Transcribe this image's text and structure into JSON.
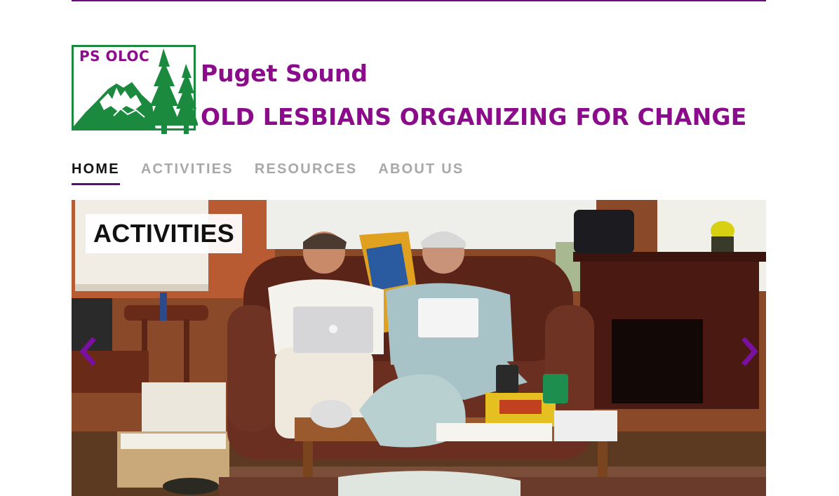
{
  "header": {
    "logo_abbrev": "PS OLOC",
    "title_line1": "Puget Sound",
    "title_line2": "OLD LESBIANS ORGANIZING FOR CHANGE"
  },
  "nav": {
    "items": [
      {
        "label": "HOME",
        "active": true
      },
      {
        "label": "ACTIVITIES",
        "active": false
      },
      {
        "label": "RESOURCES",
        "active": false
      },
      {
        "label": "ABOUT US",
        "active": false
      }
    ]
  },
  "hero": {
    "caption": "ACTIVITIES",
    "prev_icon": "chevron-left-icon",
    "next_icon": "chevron-right-icon"
  },
  "colors": {
    "brand_purple": "#8b0c8a",
    "rule_purple": "#6b0d7a",
    "logo_green": "#1b8a3e",
    "nav_inactive": "#a8a8a8",
    "nav_active": "#111111",
    "arrow_purple": "#7a10a0"
  }
}
